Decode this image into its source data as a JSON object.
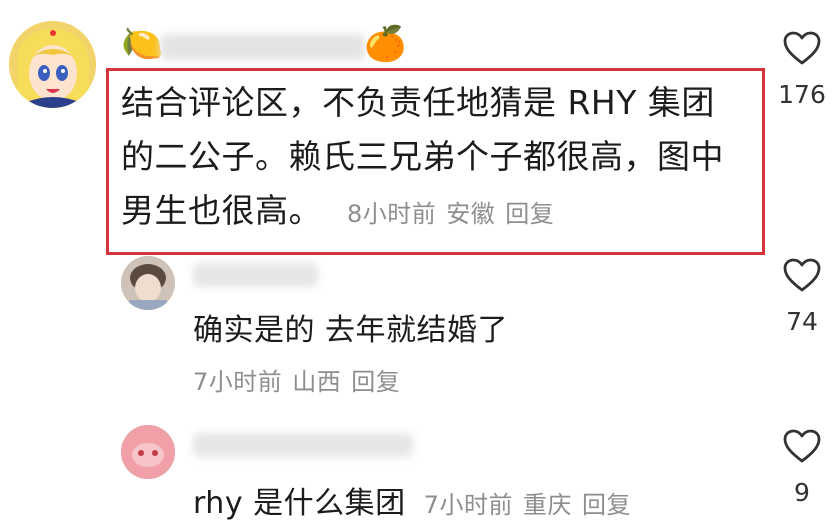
{
  "main_comment": {
    "text": "结合评论区，不负责任地猜是 RHY 集团的二公子。赖氏三兄弟个子都很高，图中男生也很高。",
    "time": "8小时前",
    "location": "安徽",
    "reply_label": "回复",
    "like_count": "176",
    "emoji_left": "🍋",
    "emoji_right": "🍊"
  },
  "replies": [
    {
      "text": "确实是的 去年就结婚了",
      "time": "7小时前",
      "location": "山西",
      "reply_label": "回复",
      "like_count": "74"
    },
    {
      "text": "rhy 是什么集团",
      "time": "7小时前",
      "location": "重庆",
      "reply_label": "回复",
      "like_count": "9"
    }
  ],
  "colors": {
    "highlight_border": "#d8323a",
    "meta_text": "#8e8e8e"
  },
  "icons": {
    "like": "heart-outline-icon"
  }
}
